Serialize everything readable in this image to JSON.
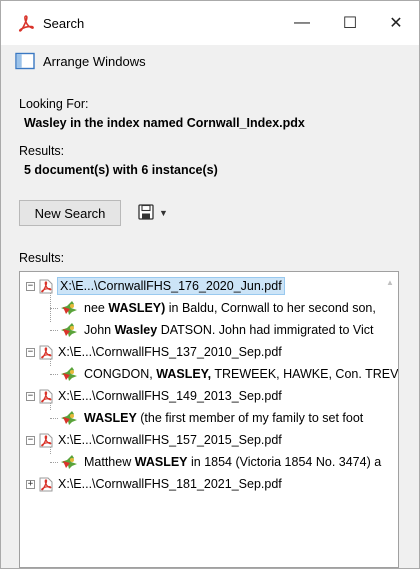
{
  "window": {
    "title": "Search",
    "minimize_glyph": "—",
    "maximize_glyph": "☐",
    "close_glyph": "✕"
  },
  "toolbar": {
    "arrange_windows_label": "Arrange Windows"
  },
  "query": {
    "looking_for_label": "Looking For:",
    "looking_for_value": "Wasley in the index named Cornwall_Index.pdx",
    "results_label": "Results:",
    "results_summary": "5 document(s) with 6 instance(s)"
  },
  "actions": {
    "new_search_label": "New Search",
    "save_dropdown_glyph": "▼"
  },
  "results_panel": {
    "label": "Results:",
    "documents": [
      {
        "name": "X:\\E...\\CornwallFHS_176_2020_Jun.pdf",
        "expanded": true,
        "selected": true,
        "hits": [
          {
            "before": "nee ",
            "match": "WASLEY)",
            "after": " in Baldu, Cornwall to her second son,"
          },
          {
            "before": "John ",
            "match": "Wasley",
            "after": " DATSON. John had immigrated to Vict"
          }
        ]
      },
      {
        "name": "X:\\E...\\CornwallFHS_137_2010_Sep.pdf",
        "expanded": true,
        "selected": false,
        "hits": [
          {
            "before": "CONGDON, ",
            "match": "WASLEY,",
            "after": " TREWEEK, HAWKE, Con. TREV"
          }
        ]
      },
      {
        "name": "X:\\E...\\CornwallFHS_149_2013_Sep.pdf",
        "expanded": true,
        "selected": false,
        "hits": [
          {
            "before": "",
            "match": "WASLEY",
            "after": " (the first member of my family to set foot"
          }
        ]
      },
      {
        "name": "X:\\E...\\CornwallFHS_157_2015_Sep.pdf",
        "expanded": true,
        "selected": false,
        "hits": [
          {
            "before": "Matthew ",
            "match": "WASLEY",
            "after": " in 1854 (Victoria 1854 No. 3474) a"
          }
        ]
      },
      {
        "name": "X:\\E...\\CornwallFHS_181_2021_Sep.pdf",
        "expanded": false,
        "selected": false,
        "hits": []
      }
    ]
  },
  "colors": {
    "acrobat_red": "#d9342b",
    "selection_bg": "#cce4f7",
    "hit_green": "#5aa33a"
  }
}
